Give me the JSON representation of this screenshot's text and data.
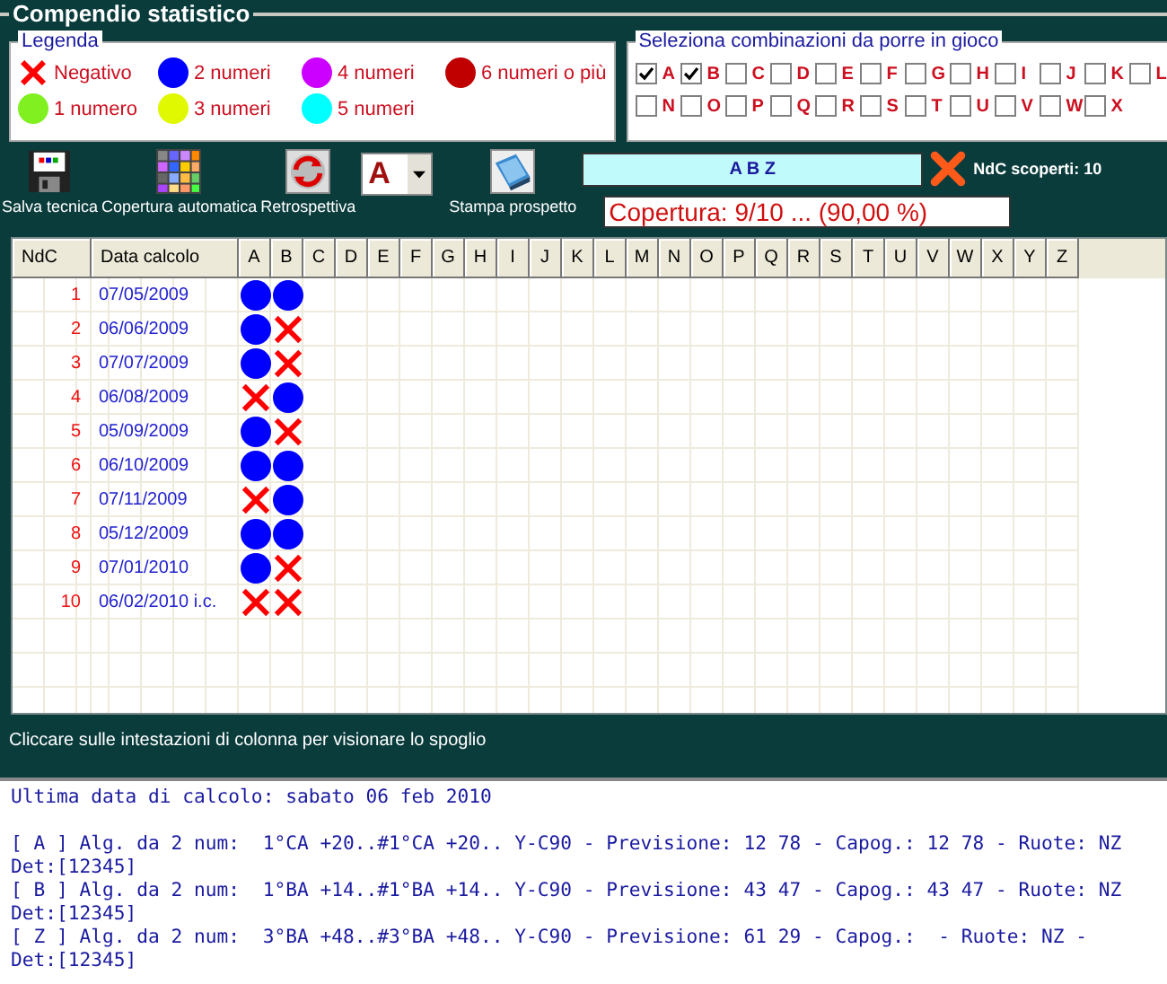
{
  "title": "Compendio statistico",
  "legend": {
    "title": "Legenda",
    "items": [
      {
        "kind": "cross",
        "label": "Negativo"
      },
      {
        "kind": "dot",
        "color": "#0000ff",
        "label": "2 numeri"
      },
      {
        "kind": "dot",
        "color": "#cc00ff",
        "label": "4 numeri"
      },
      {
        "kind": "dot",
        "color": "#c00000",
        "label": "6 numeri o più"
      },
      {
        "kind": "dot",
        "color": "#80f020",
        "label": "1 numero"
      },
      {
        "kind": "dot",
        "color": "#e0f800",
        "label": "3 numeri"
      },
      {
        "kind": "dot",
        "color": "#00ffff",
        "label": "5 numeri"
      }
    ]
  },
  "selection": {
    "title": "Seleziona combinazioni da porre in gioco",
    "options": [
      {
        "label": "A",
        "checked": true
      },
      {
        "label": "B",
        "checked": true
      },
      {
        "label": "C",
        "checked": false
      },
      {
        "label": "D",
        "checked": false
      },
      {
        "label": "E",
        "checked": false
      },
      {
        "label": "F",
        "checked": false
      },
      {
        "label": "G",
        "checked": false
      },
      {
        "label": "H",
        "checked": false
      },
      {
        "label": "I",
        "checked": false
      },
      {
        "label": "J",
        "checked": false
      },
      {
        "label": "K",
        "checked": false
      },
      {
        "label": "L",
        "checked": false
      },
      {
        "label": "N",
        "checked": false
      },
      {
        "label": "O",
        "checked": false
      },
      {
        "label": "P",
        "checked": false
      },
      {
        "label": "Q",
        "checked": false
      },
      {
        "label": "R",
        "checked": false
      },
      {
        "label": "S",
        "checked": false
      },
      {
        "label": "T",
        "checked": false
      },
      {
        "label": "U",
        "checked": false
      },
      {
        "label": "V",
        "checked": false
      },
      {
        "label": "W",
        "checked": false
      },
      {
        "label": "X",
        "checked": false
      }
    ]
  },
  "toolbar": [
    {
      "kind": "floppy",
      "label": "Salva tecnica"
    },
    {
      "kind": "grid",
      "label": "Copertura automatica"
    },
    {
      "kind": "refresh",
      "label": "Retrospettiva"
    },
    {
      "kind": "dropdown",
      "value": "A"
    },
    {
      "kind": "print",
      "label": "Stampa prospetto"
    }
  ],
  "combination_field": {
    "value": "A B Z"
  },
  "uncovered": "NdC scoperti: 10",
  "coverage": "Copertura: 9/10 ... (90,00 %)",
  "table": {
    "columns": [
      "NdC",
      "Data calcolo",
      "A",
      "B",
      "C",
      "D",
      "E",
      "F",
      "G",
      "H",
      "I",
      "J",
      "K",
      "L",
      "M",
      "N",
      "O",
      "P",
      "Q",
      "R",
      "S",
      "T",
      "U",
      "V",
      "W",
      "X",
      "Y",
      "Z"
    ],
    "rows": [
      {
        "ndc": "1",
        "date": "07/05/2009",
        "marks": [
          {
            "kind": "dot",
            "color": "#0000ff"
          },
          {
            "kind": "dot",
            "color": "#0000ff"
          }
        ]
      },
      {
        "ndc": "2",
        "date": "06/06/2009",
        "marks": [
          {
            "kind": "dot",
            "color": "#0000ff"
          },
          {
            "kind": "cross"
          }
        ]
      },
      {
        "ndc": "3",
        "date": "07/07/2009",
        "marks": [
          {
            "kind": "dot",
            "color": "#0000ff"
          },
          {
            "kind": "cross"
          }
        ]
      },
      {
        "ndc": "4",
        "date": "06/08/2009",
        "marks": [
          {
            "kind": "cross"
          },
          {
            "kind": "dot",
            "color": "#0000ff"
          }
        ]
      },
      {
        "ndc": "5",
        "date": "05/09/2009",
        "marks": [
          {
            "kind": "dot",
            "color": "#0000ff"
          },
          {
            "kind": "cross"
          }
        ]
      },
      {
        "ndc": "6",
        "date": "06/10/2009",
        "marks": [
          {
            "kind": "dot",
            "color": "#0000ff"
          },
          {
            "kind": "dot",
            "color": "#0000ff"
          }
        ]
      },
      {
        "ndc": "7",
        "date": "07/11/2009",
        "marks": [
          {
            "kind": "cross"
          },
          {
            "kind": "dot",
            "color": "#0000ff"
          }
        ]
      },
      {
        "ndc": "8",
        "date": "05/12/2009",
        "marks": [
          {
            "kind": "dot",
            "color": "#0000ff"
          },
          {
            "kind": "dot",
            "color": "#0000ff"
          }
        ]
      },
      {
        "ndc": "9",
        "date": "07/01/2010",
        "marks": [
          {
            "kind": "dot",
            "color": "#0000ff"
          },
          {
            "kind": "cross"
          }
        ]
      },
      {
        "ndc": "10",
        "date": "06/02/2010 i.c.",
        "marks": [
          {
            "kind": "cross"
          },
          {
            "kind": "cross"
          }
        ]
      }
    ]
  },
  "hint": "Cliccare sulle intestazioni di colonna per visionare lo spoglio",
  "output": {
    "heading": "Ultima data di calcolo: sabato 06 feb 2010",
    "records": [
      {
        "text": "[ A ] Alg. da 2 num:  1°CA +20..#1°CA +20.. Y-C90 - Previsione: 12 78 - Capog.: 12 78 - Ruote: NZ",
        "detail": "Det:[12345]"
      },
      {
        "text": "[ B ] Alg. da 2 num:  1°BA +14..#1°BA +14.. Y-C90 - Previsione: 43 47 - Capog.: 43 47 - Ruote: NZ",
        "detail": "Det:[12345]"
      },
      {
        "text": "[ Z ] Alg. da 2 num:  3°BA +48..#3°BA +48.. Y-C90 - Previsione: 61 29 - Capog.:  - Ruote: NZ -",
        "detail": "Det:[12345]"
      }
    ]
  }
}
